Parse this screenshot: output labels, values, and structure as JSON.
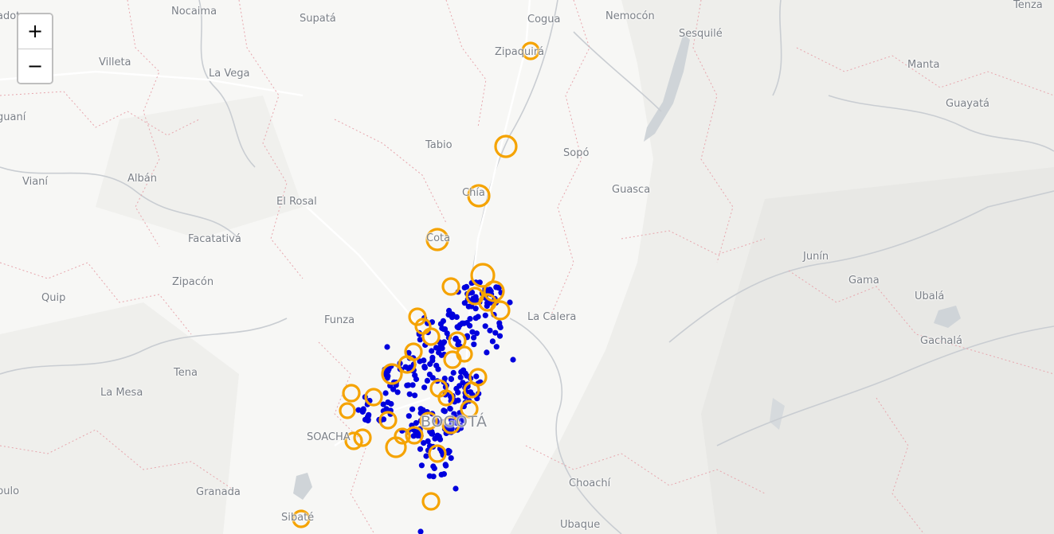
{
  "map": {
    "places": [
      {
        "name": "adota",
        "kind": "town"
      },
      {
        "name": "Nocaima",
        "kind": "town"
      },
      {
        "name": "Supatá",
        "kind": "town"
      },
      {
        "name": "Cogua",
        "kind": "town"
      },
      {
        "name": "Nemocón",
        "kind": "town"
      },
      {
        "name": "Tenza",
        "kind": "town"
      },
      {
        "name": "Sesquilé",
        "kind": "town"
      },
      {
        "name": "Zipaquirá",
        "kind": "town"
      },
      {
        "name": "Villeta",
        "kind": "town"
      },
      {
        "name": "La Vega",
        "kind": "town"
      },
      {
        "name": "Manta",
        "kind": "town"
      },
      {
        "name": "Guayatá",
        "kind": "town"
      },
      {
        "name": "guaní",
        "kind": "town"
      },
      {
        "name": "Tabio",
        "kind": "town"
      },
      {
        "name": "Sopó",
        "kind": "town"
      },
      {
        "name": "Vianí",
        "kind": "town"
      },
      {
        "name": "Albán",
        "kind": "town"
      },
      {
        "name": "Chía",
        "kind": "town"
      },
      {
        "name": "Guasca",
        "kind": "town"
      },
      {
        "name": "El Rosal",
        "kind": "town"
      },
      {
        "name": "Facatativá",
        "kind": "town"
      },
      {
        "name": "Cota",
        "kind": "town"
      },
      {
        "name": "Junín",
        "kind": "town"
      },
      {
        "name": "Zipacón",
        "kind": "town"
      },
      {
        "name": "Gama",
        "kind": "town"
      },
      {
        "name": "Quip",
        "kind": "town"
      },
      {
        "name": "Ubalá",
        "kind": "town"
      },
      {
        "name": "Funza",
        "kind": "town"
      },
      {
        "name": "La Calera",
        "kind": "town"
      },
      {
        "name": "Gachalá",
        "kind": "town"
      },
      {
        "name": "Tena",
        "kind": "town"
      },
      {
        "name": "La Mesa",
        "kind": "town"
      },
      {
        "name": "BOGOTÁ",
        "kind": "city"
      },
      {
        "name": "SOACHA",
        "kind": "town"
      },
      {
        "name": "pulo",
        "kind": "town"
      },
      {
        "name": "Granada",
        "kind": "town"
      },
      {
        "name": "Choachí",
        "kind": "town"
      },
      {
        "name": "Sibaté",
        "kind": "town"
      },
      {
        "name": "Ubaque",
        "kind": "town"
      }
    ],
    "marker_colors": {
      "large_circle": "#f5a300",
      "small_dot": "#0000dd"
    },
    "large_circle_count": 38,
    "small_dot_count": 300
  },
  "zoom": {
    "in_label": "+",
    "out_label": "−"
  }
}
